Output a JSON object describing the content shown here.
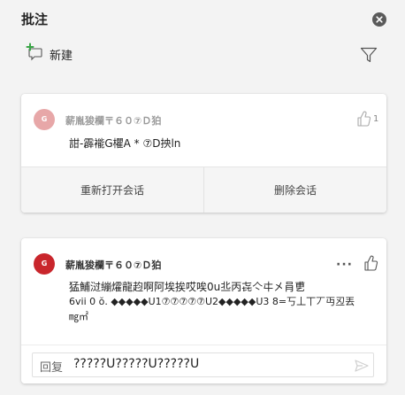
{
  "pane": {
    "title": "批注",
    "close_icon": "close-circle-icon"
  },
  "toolbar": {
    "new_label": "新建",
    "new_icon": "new-comment-icon",
    "filter_icon": "filter-icon"
  },
  "comments": [
    {
      "avatar_initial": "G",
      "author": "薪胤狻欄〒６０⑦Ｄ狛",
      "text": "詌-霹褦G欋A * ⑦D抰ln",
      "like_count": "1",
      "actions": {
        "reopen": "重新打开会话",
        "delete": "删除会话"
      }
    },
    {
      "avatar_initial": "G",
      "author": "薪胤狻欄〒６０⑦Ｄ狛",
      "text_lines": [
        "猛鯆㳡繃㸌龍赹啊阿埃挨哎唉0u丠丙㐂亽㐄㐅肙乶",
        "6vii 0 ŏ. ◆◆◆◆◆U1⑦⑦⑦⑦⑦U2◆◆◆◆◆U3  8=丂丄丅丆丏丒丟",
        "㎎㎡"
      ],
      "more_label": "···",
      "reply": {
        "label": "回复",
        "value": "?????U?????U?????U"
      }
    }
  ],
  "colors": {
    "avatar_faded": "#e7a7a8",
    "avatar_active": "#c9262c",
    "pane_bg": "#f3f3f3",
    "new_icon_accent": "#3aa547"
  }
}
